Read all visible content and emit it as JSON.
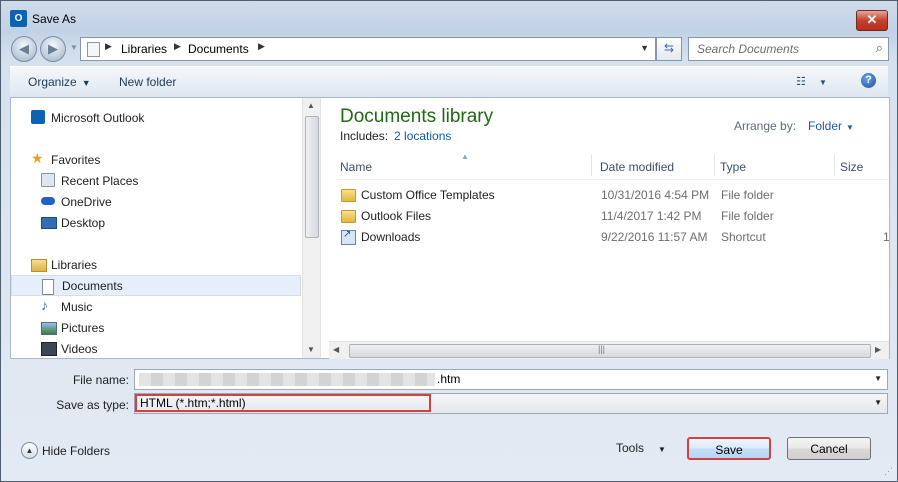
{
  "window": {
    "title": "Save As",
    "app_icon": "outlook-icon",
    "close_label": "✕"
  },
  "address": {
    "crumbs": [
      "Libraries",
      "Documents"
    ],
    "search_placeholder": "Search Documents"
  },
  "command_bar": {
    "organize": "Organize",
    "new_folder": "New folder"
  },
  "navigation": {
    "items": [
      {
        "label": "Microsoft Outlook",
        "icon": "outlook-icon",
        "level": 0
      },
      {
        "label": "Favorites",
        "icon": "star-icon",
        "level": 0
      },
      {
        "label": "Recent Places",
        "icon": "recent-places-icon",
        "level": 1
      },
      {
        "label": "OneDrive",
        "icon": "cloud-icon",
        "level": 1
      },
      {
        "label": "Desktop",
        "icon": "desktop-icon",
        "level": 1
      },
      {
        "label": "Libraries",
        "icon": "libraries-icon",
        "level": 0
      },
      {
        "label": "Documents",
        "icon": "documents-icon",
        "level": 1,
        "selected": true
      },
      {
        "label": "Music",
        "icon": "music-icon",
        "level": 1
      },
      {
        "label": "Pictures",
        "icon": "pictures-icon",
        "level": 1
      },
      {
        "label": "Videos",
        "icon": "videos-icon",
        "level": 1
      }
    ]
  },
  "library": {
    "title": "Documents library",
    "includes_label": "Includes:",
    "includes_link": "2 locations",
    "arrange_label": "Arrange by:",
    "arrange_value": "Folder"
  },
  "columns": [
    "Name",
    "Date modified",
    "Type",
    "Size"
  ],
  "files": [
    {
      "name": "Custom Office Templates",
      "date": "10/31/2016 4:54 PM",
      "type": "File folder",
      "size": "",
      "icon": "folder-icon"
    },
    {
      "name": "Outlook Files",
      "date": "11/4/2017 1:42 PM",
      "type": "File folder",
      "size": "",
      "icon": "folder-icon"
    },
    {
      "name": "Downloads",
      "date": "9/22/2016 11:57 AM",
      "type": "Shortcut",
      "size": "1",
      "icon": "shortcut-icon"
    }
  ],
  "form": {
    "file_name_label": "File name:",
    "file_name_suffix": ".htm",
    "save_type_label": "Save as type:",
    "save_type_value": "HTML (*.htm;*.html)"
  },
  "footer": {
    "hide_folders": "Hide Folders",
    "tools": "Tools",
    "save": "Save",
    "cancel": "Cancel"
  },
  "colors": {
    "library_title": "#1f6a13",
    "link": "#0e5aa7",
    "highlight": "#d24040"
  }
}
